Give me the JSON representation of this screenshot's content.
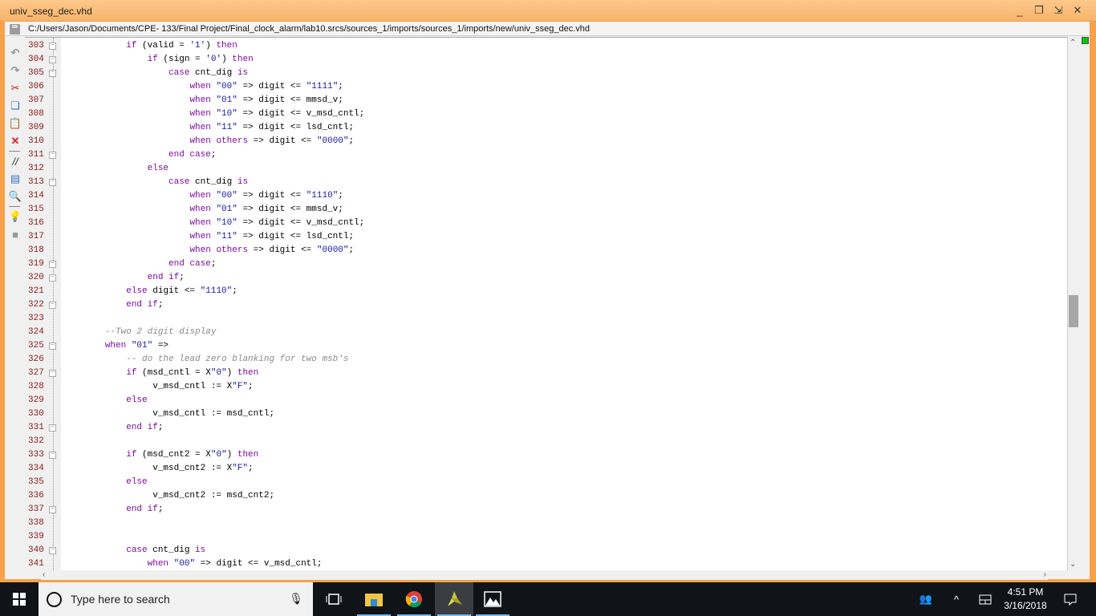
{
  "window": {
    "title": "univ_sseg_dec.vhd",
    "file_path": "C:/Users/Jason/Documents/CPE- 133/Final Project/Final_clock_alarm/lab10.srcs/sources_1/imports/sources_1/imports/new/univ_sseg_dec.vhd",
    "controls": {
      "minimize": "_",
      "restore": "❐",
      "float": "⇲",
      "close": "✕"
    }
  },
  "toolbar": {
    "icons": [
      "save-icon",
      "undo-icon",
      "redo-icon",
      "cut-icon",
      "copy-icon",
      "paste-icon",
      "delete-icon",
      "comment-icon",
      "select-all-icon",
      "find-icon",
      "hint-icon",
      "stamp-icon"
    ]
  },
  "editor": {
    "lines": [
      {
        "n": "303",
        "fold": "open",
        "html": "            <span class=\"kw\">if</span> (valid = <span class=\"str\">'1'</span>) <span class=\"kw\">then</span>"
      },
      {
        "n": "304",
        "fold": "open",
        "html": "                <span class=\"kw\">if</span> (sign = <span class=\"str\">'0'</span>) <span class=\"kw\">then</span>"
      },
      {
        "n": "305",
        "fold": "open",
        "html": "                    <span class=\"kw\">case</span> cnt_dig <span class=\"kw\">is</span>"
      },
      {
        "n": "306",
        "fold": "",
        "html": "                        <span class=\"kw\">when</span> <span class=\"str\">\"00\"</span> => digit <= <span class=\"str\">\"1111\"</span>;"
      },
      {
        "n": "307",
        "fold": "",
        "html": "                        <span class=\"kw\">when</span> <span class=\"str\">\"01\"</span> => digit <= mmsd_v;"
      },
      {
        "n": "308",
        "fold": "",
        "html": "                        <span class=\"kw\">when</span> <span class=\"str\">\"10\"</span> => digit <= v_msd_cntl;"
      },
      {
        "n": "309",
        "fold": "",
        "html": "                        <span class=\"kw\">when</span> <span class=\"str\">\"11\"</span> => digit <= lsd_cntl;"
      },
      {
        "n": "310",
        "fold": "",
        "html": "                        <span class=\"kw\">when others</span> => digit <= <span class=\"str\">\"0000\"</span>;"
      },
      {
        "n": "311",
        "fold": "close",
        "html": "                    <span class=\"kw\">end case</span>;"
      },
      {
        "n": "312",
        "fold": "",
        "html": "                <span class=\"kw\">else</span>"
      },
      {
        "n": "313",
        "fold": "open",
        "html": "                    <span class=\"kw\">case</span> cnt_dig <span class=\"kw\">is</span>"
      },
      {
        "n": "314",
        "fold": "",
        "html": "                        <span class=\"kw\">when</span> <span class=\"str\">\"00\"</span> => digit <= <span class=\"str\">\"1110\"</span>;"
      },
      {
        "n": "315",
        "fold": "",
        "html": "                        <span class=\"kw\">when</span> <span class=\"str\">\"01\"</span> => digit <= mmsd_v;"
      },
      {
        "n": "316",
        "fold": "",
        "html": "                        <span class=\"kw\">when</span> <span class=\"str\">\"10\"</span> => digit <= v_msd_cntl;"
      },
      {
        "n": "317",
        "fold": "",
        "html": "                        <span class=\"kw\">when</span> <span class=\"str\">\"11\"</span> => digit <= lsd_cntl;"
      },
      {
        "n": "318",
        "fold": "",
        "html": "                        <span class=\"kw\">when others</span> => digit <= <span class=\"str\">\"0000\"</span>;"
      },
      {
        "n": "319",
        "fold": "close",
        "html": "                    <span class=\"kw\">end case</span>;"
      },
      {
        "n": "320",
        "fold": "close",
        "html": "                <span class=\"kw\">end if</span>;"
      },
      {
        "n": "321",
        "fold": "",
        "html": "            <span class=\"kw\">else</span> digit <= <span class=\"str\">\"1110\"</span>;"
      },
      {
        "n": "322",
        "fold": "close",
        "html": "            <span class=\"kw\">end if</span>;"
      },
      {
        "n": "323",
        "fold": "",
        "html": ""
      },
      {
        "n": "324",
        "fold": "",
        "html": "        <span class=\"cmt\">--Two 2 digit display</span>"
      },
      {
        "n": "325",
        "fold": "open",
        "html": "        <span class=\"kw\">when</span> <span class=\"str\">\"01\"</span> =>"
      },
      {
        "n": "326",
        "fold": "",
        "html": "            <span class=\"cmt\">-- do the lead zero blanking for two msb's</span>"
      },
      {
        "n": "327",
        "fold": "open",
        "html": "            <span class=\"kw\">if</span> (msd_cntl = X<span class=\"str\">\"0\"</span>) <span class=\"kw\">then</span>"
      },
      {
        "n": "328",
        "fold": "",
        "html": "                 v_msd_cntl := X<span class=\"str\">\"F\"</span>;"
      },
      {
        "n": "329",
        "fold": "",
        "html": "            <span class=\"kw\">else</span>"
      },
      {
        "n": "330",
        "fold": "",
        "html": "                 v_msd_cntl := msd_cntl;"
      },
      {
        "n": "331",
        "fold": "close",
        "html": "            <span class=\"kw\">end if</span>;"
      },
      {
        "n": "332",
        "fold": "",
        "html": ""
      },
      {
        "n": "333",
        "fold": "open",
        "html": "            <span class=\"kw\">if</span> (msd_cnt2 = X<span class=\"str\">\"0\"</span>) <span class=\"kw\">then</span>"
      },
      {
        "n": "334",
        "fold": "",
        "html": "                 v_msd_cnt2 := X<span class=\"str\">\"F\"</span>;"
      },
      {
        "n": "335",
        "fold": "",
        "html": "            <span class=\"kw\">else</span>"
      },
      {
        "n": "336",
        "fold": "",
        "html": "                 v_msd_cnt2 := msd_cnt2;"
      },
      {
        "n": "337",
        "fold": "close",
        "html": "            <span class=\"kw\">end if</span>;"
      },
      {
        "n": "338",
        "fold": "",
        "html": ""
      },
      {
        "n": "339",
        "fold": "",
        "html": ""
      },
      {
        "n": "340",
        "fold": "open",
        "html": "            <span class=\"kw\">case</span> cnt_dig <span class=\"kw\">is</span>"
      },
      {
        "n": "341",
        "fold": "",
        "html": "                <span class=\"kw\">when</span> <span class=\"str\">\"00\"</span> => digit <= v_msd_cntl;"
      }
    ],
    "scroll_position_fraction": 0.52
  },
  "taskbar": {
    "search_placeholder": "Type here to search",
    "time": "4:51 PM",
    "date": "3/16/2018",
    "apps": [
      "task-view",
      "file-explorer",
      "chrome",
      "vivado",
      "photos"
    ]
  }
}
